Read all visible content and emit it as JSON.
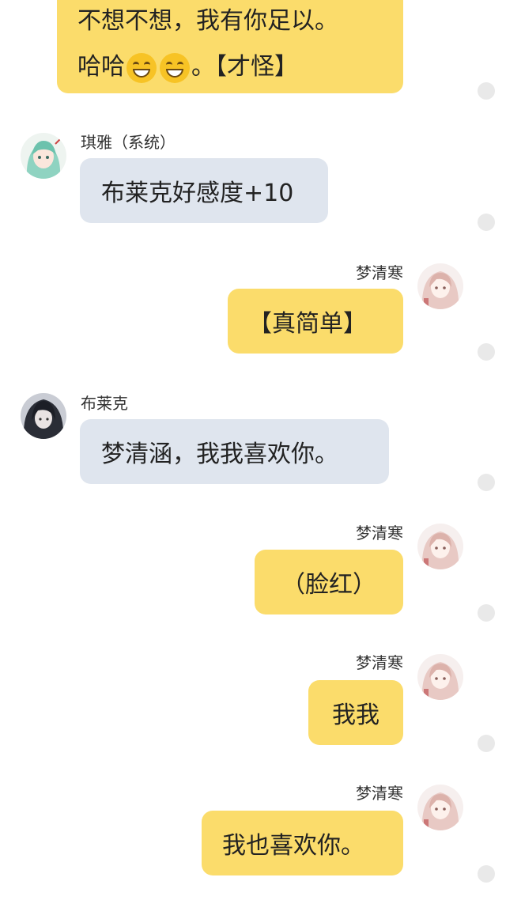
{
  "colors": {
    "self_bubble": "#fbdc6b",
    "other_bubble": "#dfe5ee",
    "background": "#ffffff"
  },
  "messages": [
    {
      "side": "right",
      "sender": "",
      "line1": "不想不想，我有你足以。",
      "line2_start": "哈哈",
      "emoji": [
        "grinning-face-emoji",
        "grinning-face-emoji"
      ],
      "line2_end": "。【才怪】"
    },
    {
      "side": "left",
      "sender": "琪雅（系统）",
      "text": "布莱克好感度+10",
      "avatar": "anime-girl-green-hair-avatar"
    },
    {
      "side": "right",
      "sender": "梦清寒",
      "text": "【真简单】",
      "avatar": "anime-girl-pink-hair-avatar"
    },
    {
      "side": "left",
      "sender": "布莱克",
      "text": "梦清涵，我我喜欢你。",
      "avatar": "dark-hair-boy-avatar"
    },
    {
      "side": "right",
      "sender": "梦清寒",
      "text": "（脸红）",
      "avatar": "anime-girl-pink-hair-avatar"
    },
    {
      "side": "right",
      "sender": "梦清寒",
      "text": "我我",
      "avatar": "anime-girl-pink-hair-avatar"
    },
    {
      "side": "right",
      "sender": "梦清寒",
      "text": "我也喜欢你。",
      "avatar": "anime-girl-pink-hair-avatar"
    }
  ]
}
